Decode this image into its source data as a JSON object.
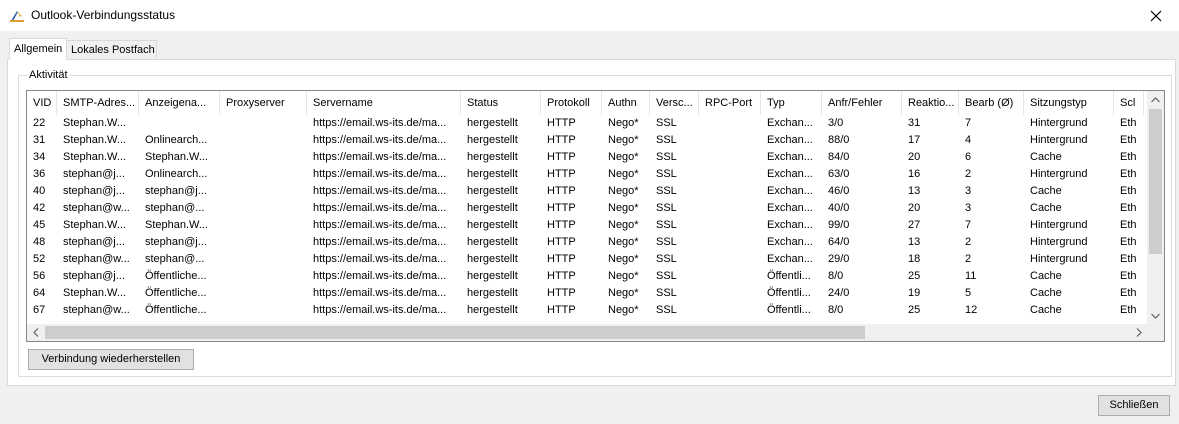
{
  "window": {
    "title": "Outlook-Verbindungsstatus"
  },
  "tabs": [
    {
      "label": "Allgemein",
      "active": true
    },
    {
      "label": "Lokales Postfach",
      "active": false
    }
  ],
  "group": {
    "legend": "Aktivität"
  },
  "table": {
    "columns": [
      "VID",
      "SMTP-Adres...",
      "Anzeigena...",
      "Proxyserver",
      "Servername",
      "Status",
      "Protokoll",
      "Authn",
      "Versc...",
      "RPC-Port",
      "Typ",
      "Anfr/Fehler",
      "Reaktio...",
      "Bearb (Ø)",
      "Sitzungstyp",
      "Scl"
    ],
    "rows": [
      [
        "22",
        "Stephan.W...",
        "",
        "",
        "https://email.ws-its.de/ma...",
        "hergestellt",
        "HTTP",
        "Nego*",
        "SSL",
        "",
        "Exchan...",
        "3/0",
        "31",
        "7",
        "Hintergrund",
        "Eth"
      ],
      [
        "31",
        "Stephan.W...",
        "Onlinearch...",
        "",
        "https://email.ws-its.de/ma...",
        "hergestellt",
        "HTTP",
        "Nego*",
        "SSL",
        "",
        "Exchan...",
        "88/0",
        "17",
        "4",
        "Hintergrund",
        "Eth"
      ],
      [
        "34",
        "Stephan.W...",
        "Stephan.W...",
        "",
        "https://email.ws-its.de/ma...",
        "hergestellt",
        "HTTP",
        "Nego*",
        "SSL",
        "",
        "Exchan...",
        "84/0",
        "20",
        "6",
        "Cache",
        "Eth"
      ],
      [
        "36",
        "stephan@j...",
        "Onlinearch...",
        "",
        "https://email.ws-its.de/ma...",
        "hergestellt",
        "HTTP",
        "Nego*",
        "SSL",
        "",
        "Exchan...",
        "63/0",
        "16",
        "2",
        "Hintergrund",
        "Eth"
      ],
      [
        "40",
        "stephan@j...",
        "stephan@j...",
        "",
        "https://email.ws-its.de/ma...",
        "hergestellt",
        "HTTP",
        "Nego*",
        "SSL",
        "",
        "Exchan...",
        "46/0",
        "13",
        "3",
        "Cache",
        "Eth"
      ],
      [
        "42",
        "stephan@w...",
        "stephan@...",
        "",
        "https://email.ws-its.de/ma...",
        "hergestellt",
        "HTTP",
        "Nego*",
        "SSL",
        "",
        "Exchan...",
        "40/0",
        "20",
        "3",
        "Cache",
        "Eth"
      ],
      [
        "45",
        "Stephan.W...",
        "Stephan.W...",
        "",
        "https://email.ws-its.de/ma...",
        "hergestellt",
        "HTTP",
        "Nego*",
        "SSL",
        "",
        "Exchan...",
        "99/0",
        "27",
        "7",
        "Hintergrund",
        "Eth"
      ],
      [
        "48",
        "stephan@j...",
        "stephan@j...",
        "",
        "https://email.ws-its.de/ma...",
        "hergestellt",
        "HTTP",
        "Nego*",
        "SSL",
        "",
        "Exchan...",
        "64/0",
        "13",
        "2",
        "Hintergrund",
        "Eth"
      ],
      [
        "52",
        "stephan@w...",
        "stephan@...",
        "",
        "https://email.ws-its.de/ma...",
        "hergestellt",
        "HTTP",
        "Nego*",
        "SSL",
        "",
        "Exchan...",
        "29/0",
        "18",
        "2",
        "Hintergrund",
        "Eth"
      ],
      [
        "56",
        "stephan@j...",
        "Öffentliche...",
        "",
        "https://email.ws-its.de/ma...",
        "hergestellt",
        "HTTP",
        "Nego*",
        "SSL",
        "",
        "Öffentli...",
        "8/0",
        "25",
        "11",
        "Cache",
        "Eth"
      ],
      [
        "64",
        "Stephan.W...",
        "Öffentliche...",
        "",
        "https://email.ws-its.de/ma...",
        "hergestellt",
        "HTTP",
        "Nego*",
        "SSL",
        "",
        "Öffentli...",
        "24/0",
        "19",
        "5",
        "Cache",
        "Eth"
      ],
      [
        "67",
        "stephan@w...",
        "Öffentliche...",
        "",
        "https://email.ws-its.de/ma...",
        "hergestellt",
        "HTTP",
        "Nego*",
        "SSL",
        "",
        "Öffentli...",
        "8/0",
        "25",
        "12",
        "Cache",
        "Eth"
      ]
    ]
  },
  "buttons": {
    "reconnect": "Verbindung wiederherstellen",
    "close": "Schließen"
  },
  "icons": {
    "app": "outlook-connection-icon",
    "close": "close-icon"
  }
}
